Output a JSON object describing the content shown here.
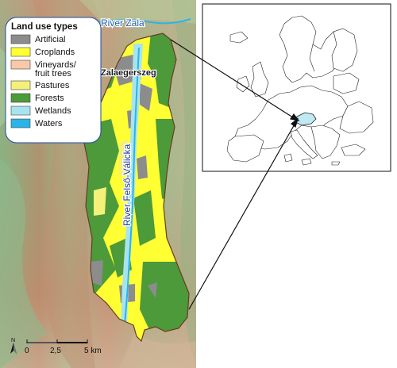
{
  "legend": {
    "title": "Land use types",
    "items": [
      {
        "label": "Artificial",
        "color": "#8c8c8c"
      },
      {
        "label": "Croplands",
        "color": "#ffff33"
      },
      {
        "label": "Vineyards/",
        "label2": "fruit trees",
        "color": "#f8c8a8"
      },
      {
        "label": "Pastures",
        "color": "#f4f07a"
      },
      {
        "label": "Forests",
        "color": "#4c9a3a"
      },
      {
        "label": "Wetlands",
        "color": "#a8e4f0"
      },
      {
        "label": "Waters",
        "color": "#2ab4e8"
      }
    ]
  },
  "labels": {
    "river_zala": "River Zala",
    "city": "Zalaegerszeg",
    "river_main": "River Felső-Válicka"
  },
  "scale_bar": {
    "north": "N",
    "ticks": [
      "0",
      "2,5",
      "5 km"
    ]
  },
  "colors": {
    "relief_green": "#6fa576",
    "relief_brown": "#b77a5e",
    "relief_pale": "#cfd7b8",
    "catchment_outline": "#6b3a22",
    "inset_highlight": "#bfeaf4"
  }
}
